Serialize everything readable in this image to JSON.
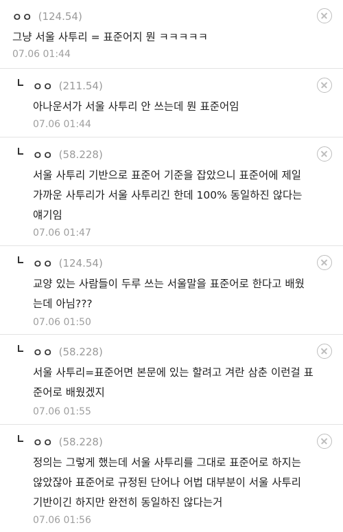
{
  "comments": [
    {
      "nick": "ㅇㅇ",
      "ip": "(124.54)",
      "text": "그냥 서울 사투리 = 표준어지 뭔 ㅋㅋㅋㅋㅋ",
      "time": "07.06 01:44",
      "reply": false
    },
    {
      "nick": "ㅇㅇ",
      "ip": "(211.54)",
      "text": "아나운서가 서울 사투리 안 쓰는데 뭔 표준어임",
      "time": "07.06 01:44",
      "reply": true
    },
    {
      "nick": "ㅇㅇ",
      "ip": "(58.228)",
      "text": "서울 사투리 기반으로 표준어 기준을 잡았으니 표준어에 제일\n가까운 사투리가 서울 사투리긴 한데 100% 동일하진 않다는\n얘기임",
      "time": "07.06 01:47",
      "reply": true
    },
    {
      "nick": "ㅇㅇ",
      "ip": "(124.54)",
      "text": "교양 있는 사람들이 두루 쓰는 서울말을 표준어로 한다고 배웠\n는데 아님???",
      "time": "07.06 01:50",
      "reply": true
    },
    {
      "nick": "ㅇㅇ",
      "ip": "(58.228)",
      "text": "서울 사투리=표준어면 본문에 있는 할려고 겨란 삼춘 이런걸 표\n준어로 배웠겠지",
      "time": "07.06 01:55",
      "reply": true
    },
    {
      "nick": "ㅇㅇ",
      "ip": "(58.228)",
      "text": "정의는 그렇게 했는데 서울 사투리를 그대로 표준어로 하지는\n않았잖아 표준어로 규정된 단어나 어법 대부분이 서울 사투리\n기반이긴 하지만 완전히 동일하진 않다는거",
      "time": "07.06 01:56",
      "reply": true
    }
  ]
}
